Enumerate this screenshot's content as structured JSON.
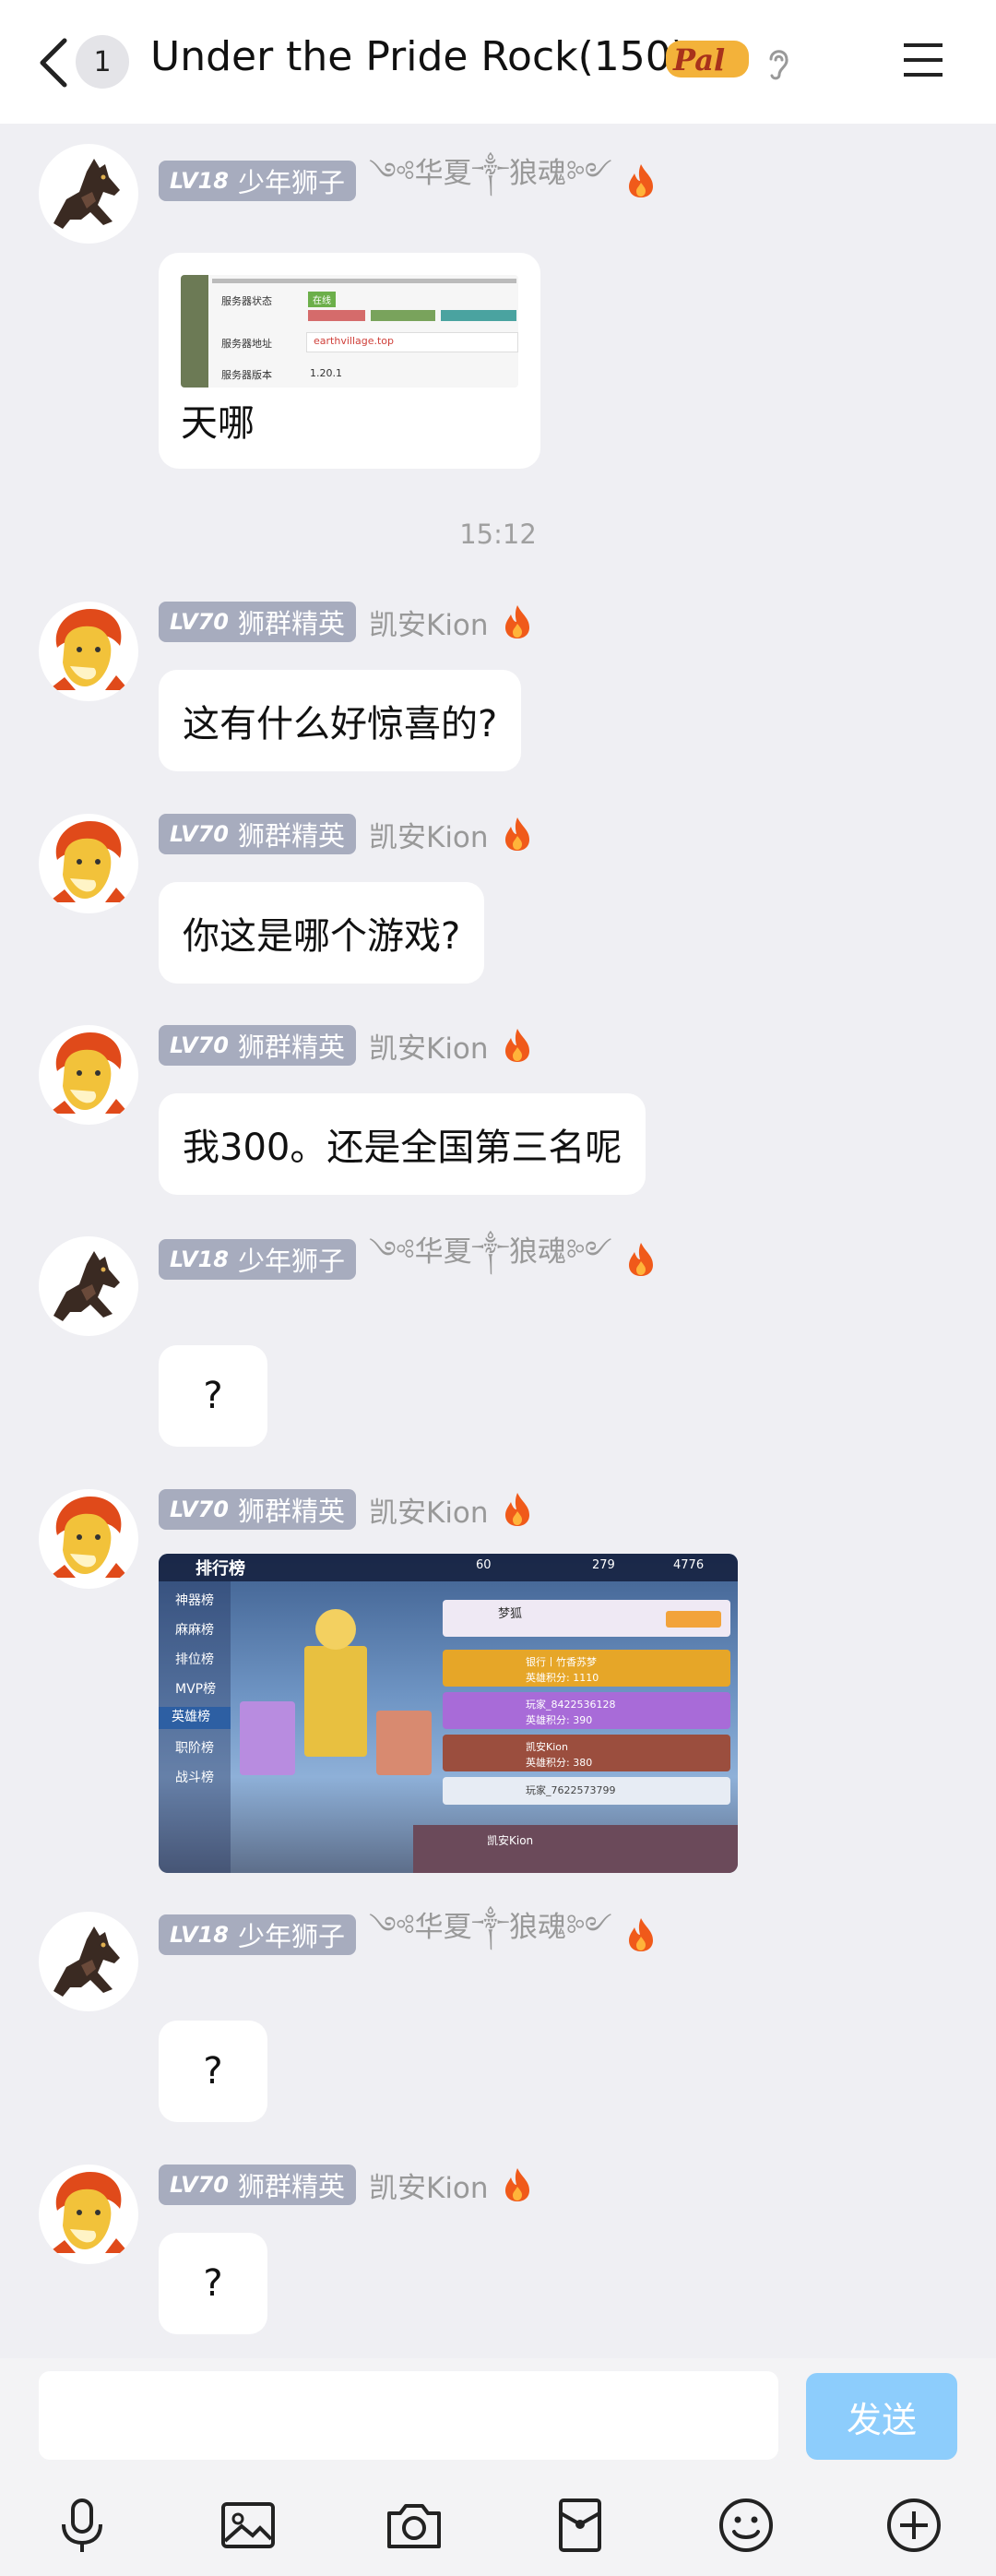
{
  "header": {
    "back_count": "1",
    "title": "Under the Pride Rock(150)",
    "logo_text": "Pal"
  },
  "users": {
    "wolf": {
      "level": "LV18",
      "title": "少年狮子",
      "name": "༺华夏༒狼魂༻"
    },
    "kion": {
      "level": "LV70",
      "title": "狮群精英",
      "name": "凯安Kion"
    }
  },
  "messages": {
    "m1": {
      "text": "天哪",
      "preview": {
        "row1_label": "服务器状态",
        "row1_tag": "在线",
        "row2_label": "服务器地址",
        "row2_value": "earthvillage.top",
        "row3_label": "服务器版本",
        "row3_value": "1.20.1"
      }
    },
    "time": "15:12",
    "m2": {
      "text": "这有什么好惊喜的?"
    },
    "m3": {
      "text": "你这是哪个游戏?"
    },
    "m4": {
      "text": "我300。还是全国第三名呢"
    },
    "m5": {
      "text": "?"
    },
    "m6": {
      "game": {
        "title": "排行榜",
        "stat1": "60",
        "stat2": "279",
        "stat3": "4776",
        "menu": [
          "神器榜",
          "麻麻榜",
          "排位榜",
          "MVP榜",
          "英雄榜",
          "职阶榜",
          "战斗榜"
        ],
        "rows": [
          {
            "name": "梦狐",
            "detail": ""
          },
          {
            "name": "银行丨竹香苏梦",
            "detail": "英雄积分: 1110"
          },
          {
            "name": "玩家_8422536128",
            "detail": "英雄积分: 390"
          },
          {
            "name": "凯安Kion",
            "detail": "英雄积分: 380"
          },
          {
            "name": "玩家_7622573799",
            "detail": ""
          }
        ],
        "self": "凯安Kion"
      }
    },
    "m7": {
      "text": "?"
    },
    "m8": {
      "text": "?"
    }
  },
  "input": {
    "placeholder": "",
    "value": "",
    "send_label": "发送"
  },
  "toolbar": [
    "microphone-icon",
    "image-icon",
    "camera-icon",
    "red-packet-icon",
    "emoji-icon",
    "plus-icon"
  ],
  "colors": {
    "send": "#8dcdfc",
    "level_tag": "#a7acbe",
    "flame": "#f05a1a"
  }
}
